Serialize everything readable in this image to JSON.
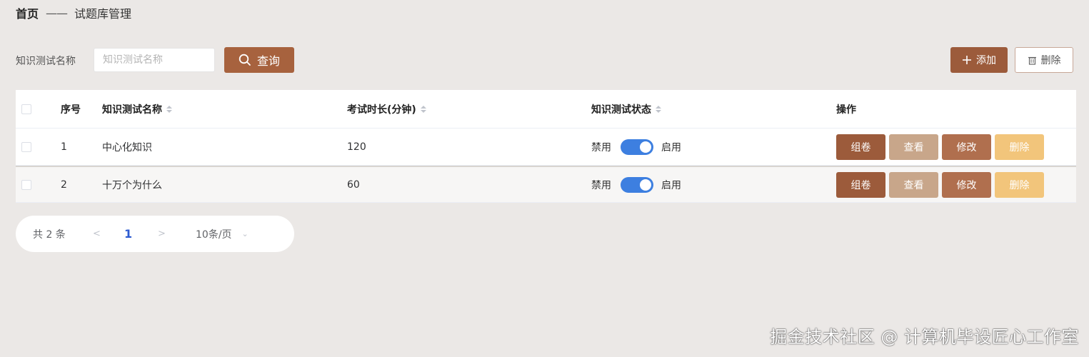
{
  "breadcrumb": {
    "home": "首页",
    "separator": "——",
    "current": "试题库管理"
  },
  "search": {
    "label": "知识测试名称",
    "placeholder": "知识测试名称",
    "value": ""
  },
  "toolbar": {
    "query_label": "查询",
    "add_label": "添加",
    "delete_label": "删除"
  },
  "table": {
    "columns": {
      "index": "序号",
      "name": "知识测试名称",
      "duration": "考试时长(分钟)",
      "status": "知识测试状态",
      "ops": "操作"
    },
    "status_off": "禁用",
    "status_on": "启用",
    "ops": {
      "compose": "组卷",
      "view": "查看",
      "edit": "修改",
      "delete": "删除"
    },
    "rows": [
      {
        "index": "1",
        "name": "中心化知识",
        "duration": "120",
        "enabled": true
      },
      {
        "index": "2",
        "name": "十万个为什么",
        "duration": "60",
        "enabled": true
      }
    ]
  },
  "pagination": {
    "total": "共 2 条",
    "prev": "<",
    "page": "1",
    "next": ">",
    "page_size": "10条/页"
  },
  "watermark": "掘金技术社区 @ 计算机毕设匠心工作室",
  "colors": {
    "primary": "#a7623e",
    "view": "#c8a68a",
    "edit": "#b06f4e",
    "delete": "#f2c57b",
    "switch_on": "#3d7fe0",
    "background": "#ebe8e6"
  },
  "icons": [
    "search-icon",
    "plus-icon",
    "trash-icon",
    "sort-icon",
    "chevron-down-icon"
  ]
}
